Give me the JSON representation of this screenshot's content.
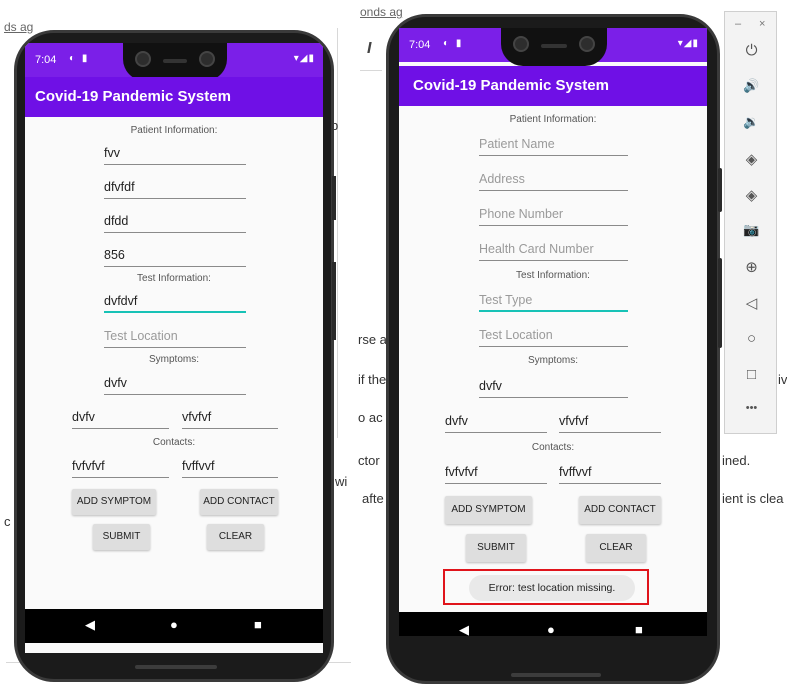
{
  "background_text": {
    "top_left": "ds ag",
    "top_right": "onds ag",
    "mid_right_1": "rse a",
    "mid_right_2": "if the",
    "mid_right_3": "o ac",
    "mid_right_4": "ctor",
    "mid_right_5": "afte",
    "far_right_1": "ined.",
    "far_right_2": "ient is clea",
    "edge_1": "b",
    "edge_2": "iv",
    "edge_3": "b",
    "left_wi": "wi",
    "left_c": "c"
  },
  "phone1": {
    "status_time": "7:04",
    "status_left_icons": "◐ ▮",
    "status_right_icons": "▾◢▮",
    "app_title": "Covid-19 Pandemic System",
    "patient_header": "Patient Information:",
    "patient_name": "fvv",
    "address": "dfvfdf",
    "phone": "dfdd",
    "health_card": "856",
    "test_header": "Test Information:",
    "test_type": "dvfdvf",
    "test_location_hint": "Test Location",
    "symptoms_header": "Symptoms:",
    "symptom_1": "dvfv",
    "symptom_2": "dvfv",
    "symptom_3": "vfvfvf",
    "contacts_header": "Contacts:",
    "contact_1": "fvfvfvf",
    "contact_2": "fvffvvf",
    "add_symptom": "ADD SYMPTOM",
    "add_contact": "ADD CONTACT",
    "submit": "SUBMIT",
    "clear": "CLEAR"
  },
  "phone2": {
    "status_time": "7:04",
    "status_left_icons": "◐ ▮",
    "status_right_icons": "▾◢▮",
    "app_title": "Covid-19 Pandemic System",
    "patient_header": "Patient Information:",
    "patient_name_hint": "Patient Name",
    "address_hint": "Address",
    "phone_hint": "Phone Number",
    "health_card_hint": "Health Card Number",
    "test_header": "Test Information:",
    "test_type_hint": "Test Type",
    "test_location_hint": "Test Location",
    "symptoms_header": "Symptoms:",
    "symptom_1": "dvfv",
    "symptom_2": "dvfv",
    "symptom_3": "vfvfvf",
    "contacts_header": "Contacts:",
    "contact_1": "fvfvfvf",
    "contact_2": "fvffvvf",
    "add_symptom": "ADD SYMPTOM",
    "add_contact": "ADD CONTACT",
    "submit": "SUBMIT",
    "clear": "CLEAR",
    "toast": "Error: test location missing."
  },
  "emulator": {
    "minimize": "–",
    "close": "×",
    "power_icon": "⏻",
    "volume_up_icon": "🔊",
    "volume_down_icon": "🔉",
    "rotate_left_icon": "◈",
    "rotate_right_icon": "◈",
    "camera_icon": "📷",
    "zoom_icon": "⊕",
    "back_icon": "◁",
    "home_icon": "○",
    "overview_icon": "□",
    "more_icon": "•••"
  },
  "nav": {
    "back": "◀",
    "home": "●",
    "recent": "■"
  },
  "colors": {
    "status": "#7b1fe8",
    "appbar": "#6f10e6",
    "focus": "#17c2b6",
    "error_box": "#e0141b"
  }
}
